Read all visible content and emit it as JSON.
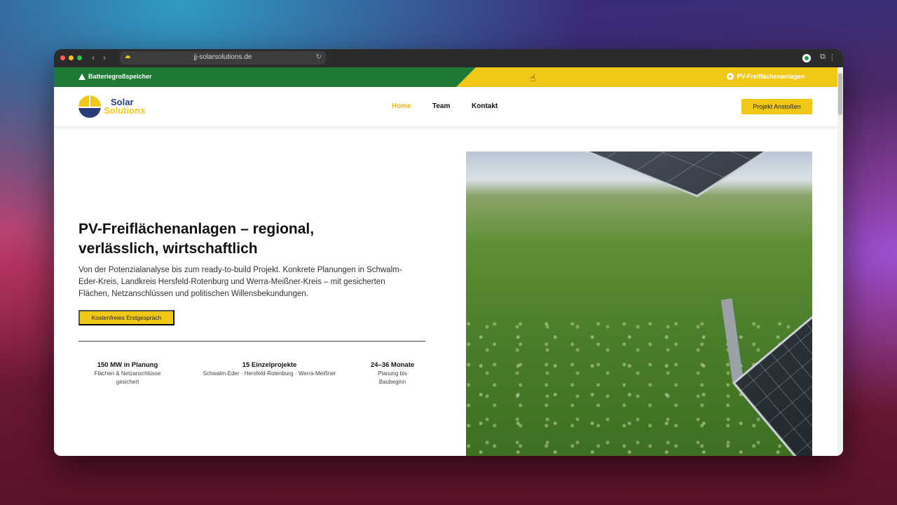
{
  "browser": {
    "url": "jj-solarsolutions.de",
    "back_glyph": "‹",
    "forward_glyph": "›",
    "reload_glyph": "↻",
    "menu_glyph": "⋮",
    "extensions_glyph": "⧉"
  },
  "topbar": {
    "left_label": "Batteriegroßspeicher",
    "right_label": "PV-Freiflächenanlagen",
    "colors": {
      "green": "#1f7a36",
      "yellow": "#f2c818"
    }
  },
  "header": {
    "logo_line1": "Solar",
    "logo_line2": "Solutions",
    "nav": [
      {
        "label": "Home",
        "active": true
      },
      {
        "label": "Team",
        "active": false
      },
      {
        "label": "Kontakt",
        "active": false
      }
    ],
    "cta_label": "Projekt Anstoßen"
  },
  "hero": {
    "title": "PV-Freiflächenanlagen – regional, verlässlich, wirtschaftlich",
    "description": "Von der Potenzialanalyse bis zum ready-to-build Projekt. Konkrete Planungen in Schwalm-Eder-Kreis, Landkreis Hersfeld-Rotenburg und Werra-Meißner-Kreis – mit gesicherten Flächen, Netzanschlüssen und politischen Willensbekundungen.",
    "cta_label": "Kostenfreies Erstgespräch",
    "image_alt": "solar-panel-field-photo"
  },
  "stats": [
    {
      "title": "150 MW in Planung",
      "sub": "Flächen & Netzanschlüsse gesichert"
    },
    {
      "title": "15 Einzelprojekte",
      "sub": "Schwalm-Eder · Hersfeld-Rotenburg · Werra-Meißner"
    },
    {
      "title": "24–36 Monate",
      "sub": "Planung bis Baubeginn"
    }
  ],
  "colors": {
    "accent_yellow": "#f2c818",
    "brand_navy": "#2a3d7a",
    "active_nav": "#e8b90f"
  }
}
